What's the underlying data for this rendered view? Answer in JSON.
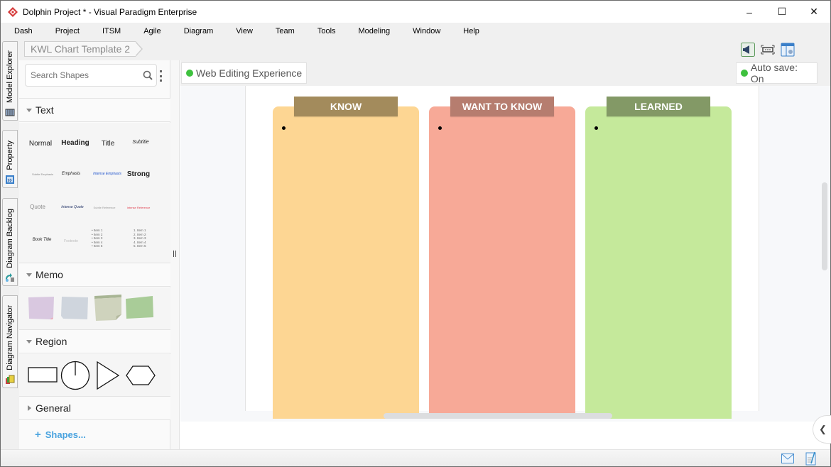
{
  "window": {
    "title": "Dolphin Project * - Visual Paradigm Enterprise",
    "controls": {
      "minimize": "–",
      "maximize": "☐",
      "close": "✕"
    }
  },
  "menu": [
    "Dash",
    "Project",
    "ITSM",
    "Agile",
    "Diagram",
    "View",
    "Team",
    "Tools",
    "Modeling",
    "Window",
    "Help"
  ],
  "left_tabs": [
    {
      "label": "Model Explorer",
      "icon": "model-explorer-icon"
    },
    {
      "label": "Property",
      "icon": "property-icon"
    },
    {
      "label": "Diagram Backlog",
      "icon": "diagram-backlog-icon"
    },
    {
      "label": "Diagram Navigator",
      "icon": "diagram-navigator-icon"
    }
  ],
  "breadcrumb": {
    "label": "KWL Chart Template 2"
  },
  "toolbar_icons": [
    "announcement-icon",
    "fit-screen-icon",
    "panel-layout-icon"
  ],
  "sidebar": {
    "search_placeholder": "Search Shapes",
    "sections": {
      "text": {
        "label": "Text",
        "styles": [
          "Normal",
          "Heading",
          "Title",
          "Subtitle",
          "Subtle Emphasis",
          "Emphasis",
          "Intense Emphasis",
          "Strong",
          "Quote",
          "Intense Quote",
          "Subtle Reference",
          "Intense Reference",
          "Book Title",
          "Footnote",
          "• Item 1\n• Item 2\n• Item 3\n• Item 4\n• Item 5",
          "1. Item 1\n2. Item 2\n3. Item 3\n4. Item 4\n5. Item 5"
        ]
      },
      "memo": {
        "label": "Memo",
        "colors": [
          "#d9c8e0",
          "#cfd5dd",
          "#cfd3bd",
          "#a9cc98"
        ]
      },
      "region": {
        "label": "Region",
        "shapes": [
          "rectangle",
          "circle",
          "triangle",
          "hexagon"
        ]
      },
      "general": {
        "label": "General"
      }
    },
    "more_shapes": "Shapes..."
  },
  "canvas": {
    "web_editing": "Web Editing Experience",
    "autosave": "Auto save: On",
    "status_color": "#3ec13e",
    "columns": [
      {
        "title": "KNOW",
        "header_color": "#a38b5c",
        "body_color": "#fdd693"
      },
      {
        "title": "WANT TO KNOW",
        "header_color": "#b67d6f",
        "body_color": "#f7a997"
      },
      {
        "title": "LEARNED",
        "header_color": "#839966",
        "body_color": "#c5e99b"
      }
    ]
  },
  "statusbar_icons": [
    "mail-icon",
    "notes-icon"
  ]
}
